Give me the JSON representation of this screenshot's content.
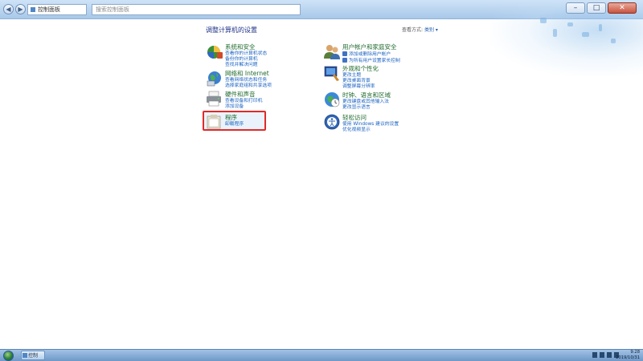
{
  "window": {
    "minimize_glyph": "–",
    "maximize_glyph": "□",
    "close_glyph": "✕"
  },
  "address_bar": {
    "back_glyph": "◀",
    "forward_glyph": "▶",
    "path_label": "控制面板"
  },
  "search": {
    "placeholder": "搜索控制面板"
  },
  "main": {
    "title": "调整计算机的设置",
    "view_by_label": "查看方式:",
    "view_by_value": "类别 ▾"
  },
  "categories": [
    {
      "title": "系统和安全",
      "links": [
        "查看你的计算机状态",
        "备份你的计算机",
        "查找并解决问题"
      ]
    },
    {
      "title": "网络和 Internet",
      "links": [
        "查看网络状态和任务",
        "选择家庭组和共享选项"
      ]
    },
    {
      "title": "硬件和声音",
      "links": [
        "查看设备和打印机",
        "添加设备"
      ]
    },
    {
      "title": "程序",
      "links": [
        "卸载程序"
      ]
    },
    {
      "title": "用户帐户和家庭安全",
      "links": [
        "添加或删除用户帐户",
        "为所有用户设置家长控制"
      ]
    },
    {
      "title": "外观和个性化",
      "links": [
        "更改主题",
        "更改桌面背景",
        "调整屏幕分辨率"
      ]
    },
    {
      "title": "时钟、语言和区域",
      "links": [
        "更改键盘或其他输入法",
        "更改显示语言"
      ]
    },
    {
      "title": "轻松访问",
      "links": [
        "使用 Windows 建议的设置",
        "优化视频显示"
      ]
    }
  ],
  "taskbar": {
    "item_label": "控制",
    "clock_time": "9:28",
    "clock_date": "2019/10/31"
  },
  "colors": {
    "category_title": "#1f6a2d",
    "link": "#1a62c2",
    "highlight": "#e12a2a"
  }
}
